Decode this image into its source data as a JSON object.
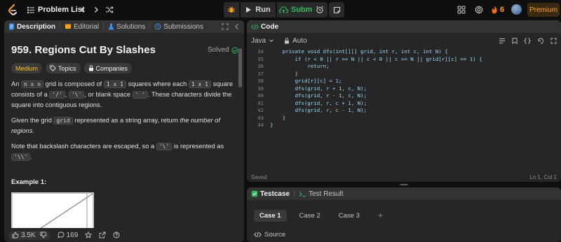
{
  "topbar": {
    "problem_list_label": "Problem List",
    "run_label": "Run",
    "submit_label": "Submit",
    "streak_count": "6",
    "premium_label": "Premium"
  },
  "left_tabs": [
    {
      "label": "Description",
      "icon": "doc-icon"
    },
    {
      "label": "Editorial",
      "icon": "book-icon"
    },
    {
      "label": "Solutions",
      "icon": "flask-icon"
    },
    {
      "label": "Submissions",
      "icon": "history-icon"
    }
  ],
  "problem": {
    "title": "959. Regions Cut By Slashes",
    "status": "Solved",
    "difficulty": "Medium",
    "topics_label": "Topics",
    "companies_label": "Companies",
    "p1_a": "An",
    "p1_code1": "n x n",
    "p1_b": "grid is composed of",
    "p1_code2": "1 x 1",
    "p1_c": "squares where each",
    "p1_code3": "1 x 1",
    "p1_d": "square consists of a",
    "p1_code4": "'/'",
    "p1_e": ",",
    "p1_code5": "'\\'",
    "p1_f": ", or blank space",
    "p1_code6": "' '",
    "p1_g": ". These characters divide the square into contiguous regions.",
    "p2_a": "Given the grid",
    "p2_code": "grid",
    "p2_b": "represented as a string array, return",
    "p2_em": "the number of regions",
    "p2_c": ".",
    "p3_a": "Note that backslash characters are escaped, so a",
    "p3_code1": "'\\'",
    "p3_b": "is represented as",
    "p3_code2": "'\\\\'",
    "p3_c": ".",
    "example_label": "Example 1:"
  },
  "bottom_bar": {
    "likes": "3.5K",
    "comments": "169"
  },
  "code_panel": {
    "tab_label": "Code",
    "language": "Java",
    "mode": "Auto",
    "saved_label": "Saved",
    "cursor_pos": "Ln 1, Col 1",
    "lines": [
      {
        "n": "34",
        "text": "    private void dfs(int[][] grid, int r, int c, int N) {"
      },
      {
        "n": "35",
        "text": "        if (r < 0 || r >= N || c < 0 || c >= N || grid[r][c] == 1) {"
      },
      {
        "n": "36",
        "text": "            return;"
      },
      {
        "n": "37",
        "text": "        }"
      },
      {
        "n": "38",
        "text": "        grid[r][c] = 1;"
      },
      {
        "n": "39",
        "text": "        dfs(grid, r + 1, c, N);"
      },
      {
        "n": "40",
        "text": "        dfs(grid, r - 1, c, N);"
      },
      {
        "n": "41",
        "text": "        dfs(grid, r, c + 1, N);"
      },
      {
        "n": "42",
        "text": "        dfs(grid, r, c - 1, N);"
      },
      {
        "n": "43",
        "text": "    }"
      },
      {
        "n": "44",
        "text": "}"
      }
    ]
  },
  "test_panel": {
    "testcase_label": "Testcase",
    "result_label": "Test Result",
    "cases": [
      "Case 1",
      "Case 2",
      "Case 3"
    ],
    "add_label": "+",
    "source_label": "Source"
  },
  "colors": {
    "accent": "#ffa116",
    "success": "#2cbb5d",
    "medium": "#ffc01e"
  }
}
